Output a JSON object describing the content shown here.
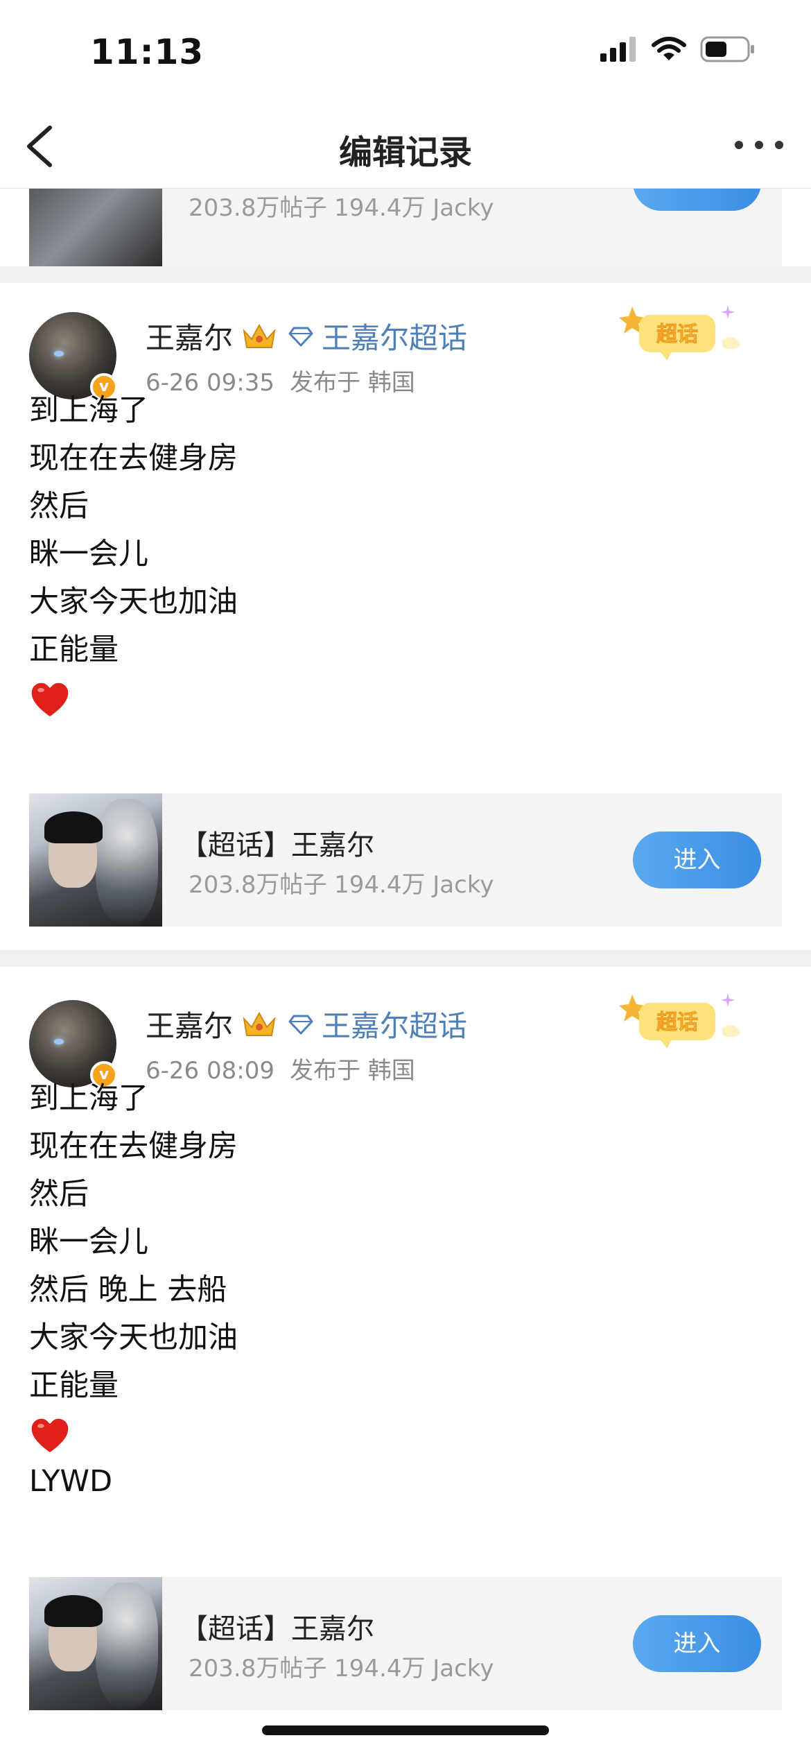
{
  "status_bar": {
    "time": "11:13"
  },
  "nav": {
    "title": "编辑记录"
  },
  "partial_card": {
    "stats": "203.8万帖子 194.4万 Jacky"
  },
  "posts": [
    {
      "author": "王嘉尔",
      "topic": "王嘉尔超话",
      "time": "6-26 09:35",
      "location": "发布于 韩国",
      "badge": "超话",
      "lines": [
        "到上海了",
        "现在在去健身房",
        "然后",
        "眯一会儿",
        "大家今天也加油",
        "正能量"
      ],
      "card": {
        "name": "【超话】王嘉尔",
        "stats": "203.8万帖子 194.4万 Jacky",
        "button": "进入"
      }
    },
    {
      "author": "王嘉尔",
      "topic": "王嘉尔超话",
      "time": "6-26 08:09",
      "location": "发布于 韩国",
      "badge": "超话",
      "lines": [
        "到上海了",
        "现在在去健身房",
        "然后",
        "眯一会儿",
        "然后 晚上 去船",
        "大家今天也加油",
        "正能量"
      ],
      "trailing": "LYWD",
      "card": {
        "name": "【超话】王嘉尔",
        "stats": "203.8万帖子 194.4万 Jacky",
        "button": "进入"
      }
    }
  ],
  "colors": {
    "link": "#4f7fb8",
    "button": "#3a8ee3",
    "heart": "#e0201b",
    "verified": "#f7a21b"
  },
  "icons": [
    "back-arrow-icon",
    "more-icon",
    "crown-icon",
    "diamond-icon",
    "chaohua-badge-icon",
    "heart-icon",
    "signal-icon",
    "wifi-icon",
    "battery-icon"
  ]
}
